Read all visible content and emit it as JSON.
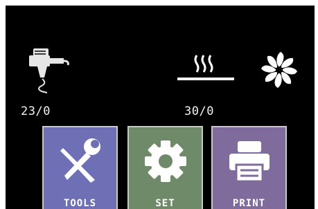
{
  "status": {
    "nozzle_temp": "23/0",
    "bed_temp": "30/0",
    "nozzle_icon": "extruder-nozzle-icon",
    "bed_icon": "heated-bed-icon",
    "fan_icon": "fan-icon"
  },
  "menu": {
    "tools": {
      "label": "TOOLS",
      "icon": "tools-wrench-screwdriver-icon",
      "color": "#6f6fb6"
    },
    "set": {
      "label": "SET",
      "icon": "gear-icon",
      "color": "#6f8a68"
    },
    "print": {
      "label": "PRINT",
      "icon": "printer-icon",
      "color": "#7f6c9c"
    }
  }
}
